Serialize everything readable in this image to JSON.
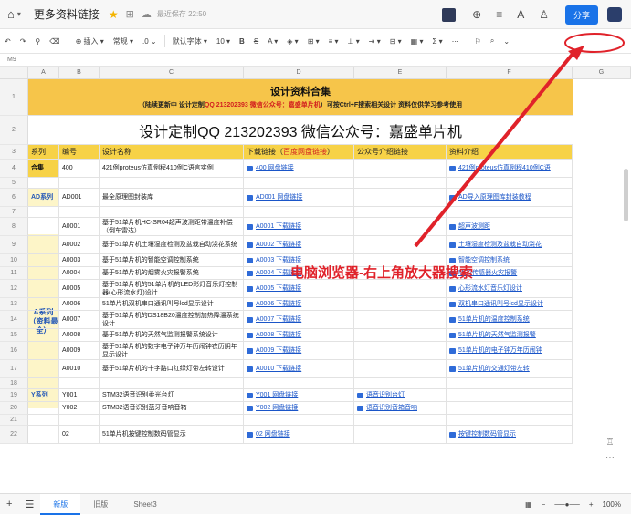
{
  "header": {
    "doc_title": "更多资料链接",
    "saved_status": "最近保存 22:50",
    "share_label": "分享"
  },
  "toolbar": {
    "insert": "插入",
    "style": "常规",
    "decimals": ".0",
    "font": "默认字体",
    "font_size": "10"
  },
  "formula": {
    "cell_ref": "M9"
  },
  "columns": [
    "A",
    "B",
    "C",
    "D",
    "E",
    "F",
    "G"
  ],
  "banner": {
    "title": "设计资料合集",
    "sub_1": "（陆续更新中 设计定制",
    "sub_qq": "QQ 213202393",
    "sub_wx": "微信公众号：嘉盛单片机",
    "sub_2": "）可按Ctrl+F搜索相关设计 资料仅供学习参考使用"
  },
  "contact_line": "设计定制QQ 213202393  微信公众号：嘉盛单片机",
  "table_header": {
    "a": "系列",
    "b": "编号",
    "c": "设计名称",
    "d": "下载链接（",
    "d_red": "百度网盘链接",
    "d_end": "）",
    "e": "公众号介绍链接",
    "f": "资料介绍"
  },
  "rows": [
    {
      "n": "4",
      "a": "合集",
      "b": "400",
      "c": "421例proteus仿真例程410例C语言实例",
      "d": "400 网盘链接",
      "e": "",
      "f": "421例proteus仿真例程410例C语"
    },
    {
      "n": "5",
      "a": "",
      "b": "",
      "c": "",
      "d": "",
      "e": "",
      "f": ""
    },
    {
      "n": "6",
      "a": "AD系列",
      "b": "AD001",
      "c": "最全原理图封装库",
      "d": "AD001 网盘链接",
      "e": "",
      "f": "AD导入原理图库封装教程"
    },
    {
      "n": "7",
      "a": "",
      "b": "",
      "c": "",
      "d": "",
      "e": "",
      "f": ""
    },
    {
      "n": "8",
      "a": "",
      "b": "A0001",
      "c": "基于51单片机HC-SR04超声波测距带温度补偿（倒车雷达）",
      "d": "A0001 下载链接",
      "e": "",
      "f": "超声波测距"
    },
    {
      "n": "9",
      "a": "",
      "b": "A0002",
      "c": "基于51单片机土壤湿度检测及盆栽自动浇花系统",
      "d": "A0002 下载链接",
      "e": "",
      "f": "土壤湿度检测及盆栽自动浇花"
    },
    {
      "n": "10",
      "a": "",
      "b": "A0003",
      "c": "基于51单片机的智能空调控制系统",
      "d": "A0003 下载链接",
      "e": "",
      "f": "智能空调控制系统"
    },
    {
      "n": "11",
      "a": "",
      "b": "A0004",
      "c": "基于51单片机的烟雾火灾报警系统",
      "d": "A0004 下载链接",
      "e": "",
      "f": "MQ2传感器火灾报警"
    },
    {
      "n": "12",
      "a": "",
      "b": "A0005",
      "c": "基于51单片机的51单片机的LED彩灯音乐灯控制器(心形流水灯)设计",
      "d": "A0005 下载链接",
      "e": "",
      "f": "心形流水灯音乐灯设计"
    },
    {
      "n": "13",
      "a": "",
      "b": "A0006",
      "c": "51单片机双机串口通讯叫号lcd显示设计",
      "d": "A0006 下载链接",
      "e": "",
      "f": "双机串口通讯叫号lcd显示设计"
    },
    {
      "n": "14",
      "a": "",
      "b": "A0007",
      "c": "基于51单片机的DS18B20温度控制加热降温系统设计",
      "d": "A0007 下载链接",
      "e": "",
      "f": "51单片机的温度控制系统"
    },
    {
      "n": "15",
      "a": "",
      "b": "A0008",
      "c": "基于51单片机的天然气监测报警系统设计",
      "d": "A0008 下载链接",
      "e": "",
      "f": "51单片机的天然气监测报警"
    },
    {
      "n": "16",
      "a": "",
      "b": "A0009",
      "c": "基于51单片机的数字电子钟万年历闹钟农历阴年显示设计",
      "d": "A0009 下载链接",
      "e": "",
      "f": "51单片机的电子钟万年历闹钟"
    },
    {
      "n": "17",
      "a": "",
      "b": "A0010",
      "c": "基于51单片机的十字路口红绿灯带左转设计",
      "d": "A0010 下载链接",
      "e": "",
      "f": "51单片机的交通灯带左转"
    },
    {
      "n": "18",
      "a": "",
      "b": "",
      "c": "",
      "d": "",
      "e": "",
      "f": ""
    },
    {
      "n": "19",
      "a": "Y系列",
      "b": "Y001",
      "c": "STM32语音识别柔光台灯",
      "d": "Y001 网盘链接",
      "e": "语音识别台灯",
      "f": ""
    },
    {
      "n": "20",
      "a": "",
      "b": "Y002",
      "c": "STM32语音识别蓝牙音响音箱",
      "d": "Y002 网盘链接",
      "e": "语音识别音箱音响",
      "f": ""
    },
    {
      "n": "21",
      "a": "",
      "b": "",
      "c": "",
      "d": "",
      "e": "",
      "f": ""
    },
    {
      "n": "22",
      "a": "",
      "b": "02",
      "c": "51单片机按键控制数码管显示",
      "d": "02 网盘链接",
      "e": "",
      "f": "按键控制数码管显示"
    }
  ],
  "series_a_label": "A系列（资料最全）",
  "annotation": "电脑浏览器-右上角放大器搜索",
  "sheets": [
    "新版",
    "旧版",
    "Sheet3"
  ],
  "zoom": "100%"
}
